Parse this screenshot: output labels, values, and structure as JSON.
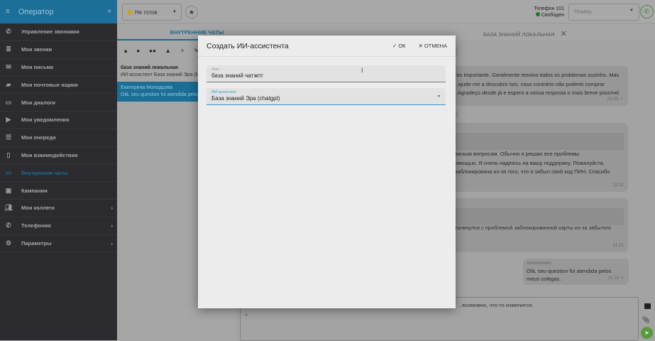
{
  "sidebar": {
    "title": "Оператор",
    "items": [
      {
        "label": "Управление звонками",
        "icon": "phone-icon"
      },
      {
        "label": "Мои звонки",
        "icon": "list-icon"
      },
      {
        "label": "Мои письма",
        "icon": "mail-icon"
      },
      {
        "label": "Мои почтовые ящики",
        "icon": "mailbox-icon"
      },
      {
        "label": "Мои диалоги",
        "icon": "chat-icon"
      },
      {
        "label": "Мои уведомления",
        "icon": "label-icon"
      },
      {
        "label": "Мои очереди",
        "icon": "queue-icon"
      },
      {
        "label": "Мои взаимодействия",
        "icon": "document-icon"
      },
      {
        "label": "Внутренние чаты",
        "icon": "chat-icon",
        "active": true
      },
      {
        "label": "Кампании",
        "icon": "briefcase-icon"
      },
      {
        "label": "Мои коллеги",
        "icon": "people-icon",
        "chevron": true
      },
      {
        "label": "Телефония",
        "icon": "phone-icon",
        "chevron": true
      },
      {
        "label": "Параметры",
        "icon": "gear-icon",
        "chevron": true
      }
    ]
  },
  "topbar": {
    "status": "Не готов",
    "status_color": "#d4a017",
    "phone_label": "Телефон 101",
    "phone_status": "Свободен",
    "phone_status_color": "#1d7a1d",
    "number_placeholder": "Номер"
  },
  "tabs": {
    "internal": "ВНУТРЕННИЕ ЧАТЫ",
    "kb": "БАЗА ЗНАНИЙ ЛОКАЛЬНАЯ"
  },
  "chat_list": [
    {
      "title": "база знаний локальная",
      "preview": "ИИ-ассистент База знаний Эра (loc"
    },
    {
      "title": "Екатерина Молодцова",
      "preview": "Olá, seu question foi atendida pelos m"
    }
  ],
  "messages": [
    {
      "lines": [
        "nto importante. Geralmente resolvo todos os problemas sozinho. Mas",
        ", ajude-me a descobrir isto, caso contrário não poderei comprar",
        ". Agradeço desde já e espero a vossa resposta o mais breve possível."
      ],
      "time": "23:05"
    },
    {
      "lines": [
        "ажным вопросам. Обычно я решаю все проблемы",
        "омощью. Я очень надеюсь на вашу поддержку. Пожалуйста,",
        "заблокирована из-за того, что я забыл свой код ПИН. Спасибо"
      ],
      "time": "11:21"
    },
    {
      "lines": [
        "толкнулся с проблемой заблокированной карты из-за забытого"
      ],
      "time": "11:21"
    },
    {
      "author": "Administrator",
      "lines": [
        "Olá, seu question foi atendida pelos meus colegas."
      ],
      "time": "11:22"
    }
  ],
  "composer": {
    "value": ", возможно, что-то изменится."
  },
  "dialog": {
    "title": "Создать ИИ-ассистента",
    "ok": "ОК",
    "cancel": "ОТМЕНА",
    "name_label": "Имя",
    "name_value": "база знаний чатжпт",
    "assistant_label": "ИИ-ассистент",
    "assistant_value": "База знаний Эра (chatgpt)"
  }
}
